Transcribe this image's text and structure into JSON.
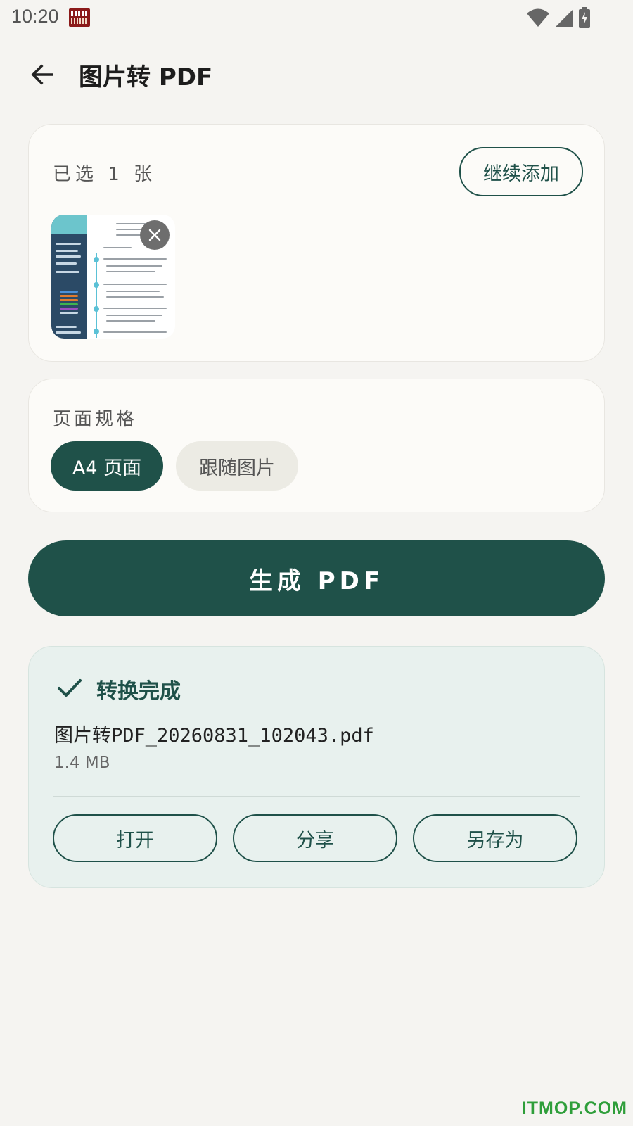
{
  "status_bar": {
    "time": "10:20"
  },
  "header": {
    "title": "图片转 PDF"
  },
  "selection": {
    "count_label": "已选 1 张",
    "add_more_label": "继续添加"
  },
  "page_size": {
    "label": "页面规格",
    "options": [
      {
        "label": "A4 页面",
        "selected": true
      },
      {
        "label": "跟随图片",
        "selected": false
      }
    ]
  },
  "generate_label": "生成 PDF",
  "result": {
    "title": "转换完成",
    "file_name": "图片转PDF_20260831_102043.pdf",
    "file_size": "1.4 MB",
    "actions": {
      "open": "打开",
      "share": "分享",
      "save_as": "另存为"
    }
  },
  "watermark": "ITMOP.COM",
  "colors": {
    "accent": "#1f5149",
    "background": "#f5f4f1",
    "result_bg": "#e8f1ee",
    "watermark": "#2e9e3a"
  },
  "icons": [
    "back-arrow-icon",
    "wifi-icon",
    "signal-icon",
    "battery-icon",
    "close-icon",
    "check-icon"
  ]
}
